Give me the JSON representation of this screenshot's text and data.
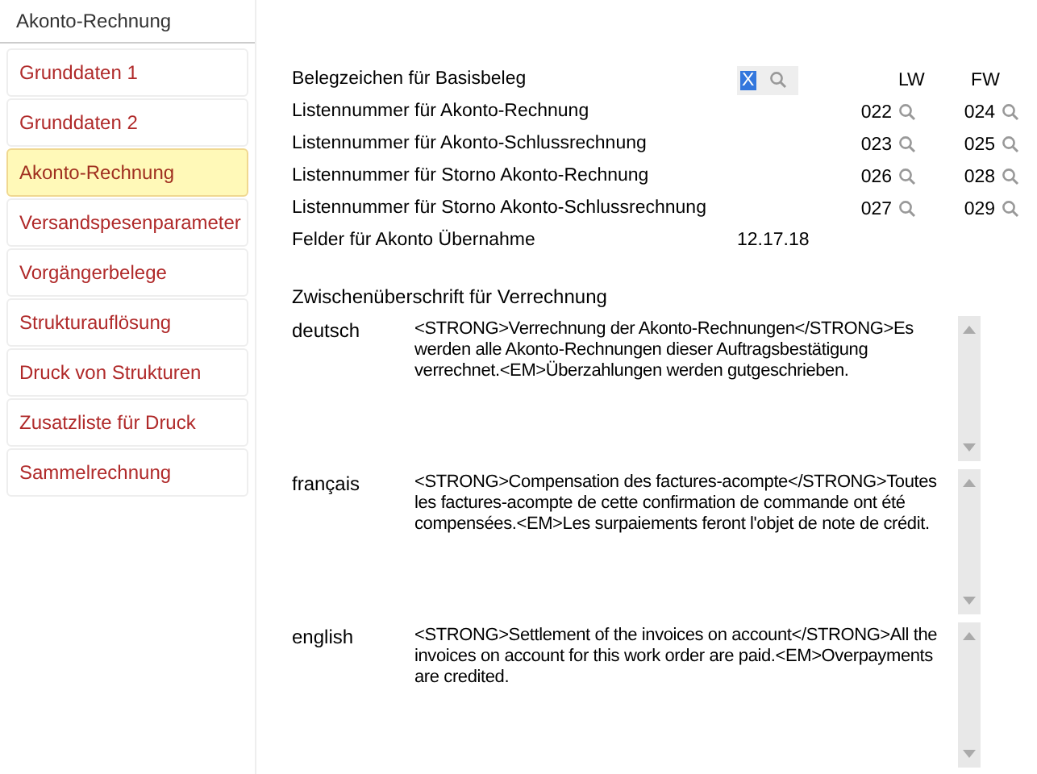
{
  "tab": {
    "title": "Akonto-Rechnung"
  },
  "sidebar": {
    "items": [
      {
        "label": "Grunddaten 1",
        "selected": false
      },
      {
        "label": "Grunddaten 2",
        "selected": false
      },
      {
        "label": "Akonto-Rechnung",
        "selected": true
      },
      {
        "label": "Versandspesenparameter",
        "selected": false
      },
      {
        "label": "Vorgängerbelege",
        "selected": false
      },
      {
        "label": "Strukturauflösung",
        "selected": false
      },
      {
        "label": "Druck von Strukturen",
        "selected": false
      },
      {
        "label": "Zusatzliste für Druck",
        "selected": false
      },
      {
        "label": "Sammelrechnung",
        "selected": false
      }
    ]
  },
  "form": {
    "columns": [
      "LW",
      "FW"
    ],
    "basis": {
      "label": "Belegzeichen für Basisbeleg",
      "value": "X",
      "selected": true
    },
    "rows": [
      {
        "label": "Listennummer für Akonto-Rechnung",
        "lw": "022",
        "fw": "024"
      },
      {
        "label": "Listennummer für Akonto-Schlussrechnung",
        "lw": "023",
        "fw": "025"
      },
      {
        "label": "Listennummer für Storno Akonto-Rechnung",
        "lw": "026",
        "fw": "028"
      },
      {
        "label": "Listennummer für Storno Akonto-Schlussrechnung",
        "lw": "027",
        "fw": "029"
      }
    ],
    "fields": {
      "label": "Felder für Akonto Übernahme",
      "value": "12.17.18"
    }
  },
  "subheading": {
    "title": "Zwischenüberschrift für Verrechnung",
    "languages": [
      {
        "label": "deutsch",
        "text": "<STRONG>Verrechnung der Akonto-Rechnungen</STRONG>Es werden alle Akonto-Rechnungen dieser Auftragsbestätigung verrechnet.<EM>Überzahlungen werden gutgeschrieben."
      },
      {
        "label": "français",
        "text": "<STRONG>Compensation des factures-acompte</STRONG>Toutes les factures-acompte de cette confirmation de commande ont été compensées.<EM>Les surpaiements feront l'objet de note de crédit."
      },
      {
        "label": "english",
        "text": "<STRONG>Settlement of the invoices on account</STRONG>All the invoices on account for this work order are paid.<EM>Overpayments are credited."
      }
    ]
  }
}
